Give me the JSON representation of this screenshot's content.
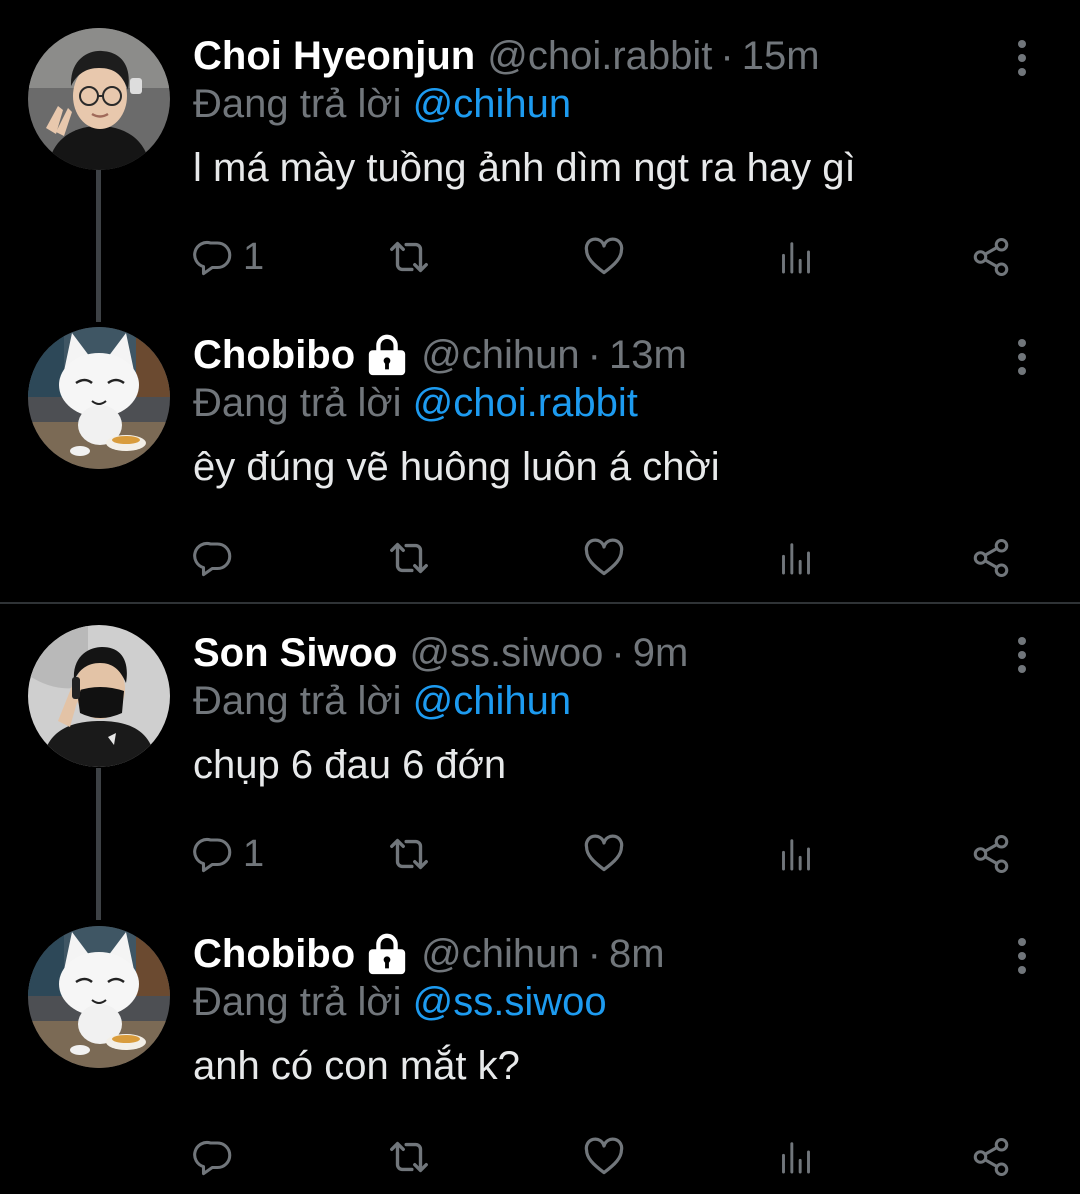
{
  "reply_prefix": "Đang trả lời",
  "tweets": [
    {
      "name": "Choi Hyeonjun",
      "handle": "@choi.rabbit",
      "separator": "·",
      "time": "15m",
      "reply_to": "@chihun",
      "text": "l má mày tuồng ảnh dìm ngt ra hay gì",
      "reply_count": "1",
      "locked": false,
      "avatar": "person-glasses-avatar"
    },
    {
      "name": "Chobibo",
      "handle": "@chihun",
      "separator": "·",
      "time": "13m",
      "reply_to": "@choi.rabbit",
      "text": "êy đúng vẽ huông luôn á chời",
      "reply_count": "",
      "locked": true,
      "avatar": "white-cat-avatar"
    },
    {
      "name": "Son Siwoo",
      "handle": "@ss.siwoo",
      "separator": "·",
      "time": "9m",
      "reply_to": "@chihun",
      "text": "chụp 6 đau 6 đớn",
      "reply_count": "1",
      "locked": false,
      "avatar": "person-mask-avatar"
    },
    {
      "name": "Chobibo",
      "handle": "@chihun",
      "separator": "·",
      "time": "8m",
      "reply_to": "@ss.siwoo",
      "text": "anh có con mắt k?",
      "reply_count": "",
      "locked": true,
      "avatar": "white-cat-avatar"
    }
  ],
  "colors": {
    "background": "#000000",
    "name": "#ffffff",
    "muted": "#71767b",
    "mention": "#1d9bf0",
    "text": "#e7e9ea",
    "thread_line": "#3d4145"
  },
  "icons": [
    "reply-icon",
    "retweet-icon",
    "like-icon",
    "views-icon",
    "share-icon",
    "more-icon",
    "lock-icon"
  ]
}
